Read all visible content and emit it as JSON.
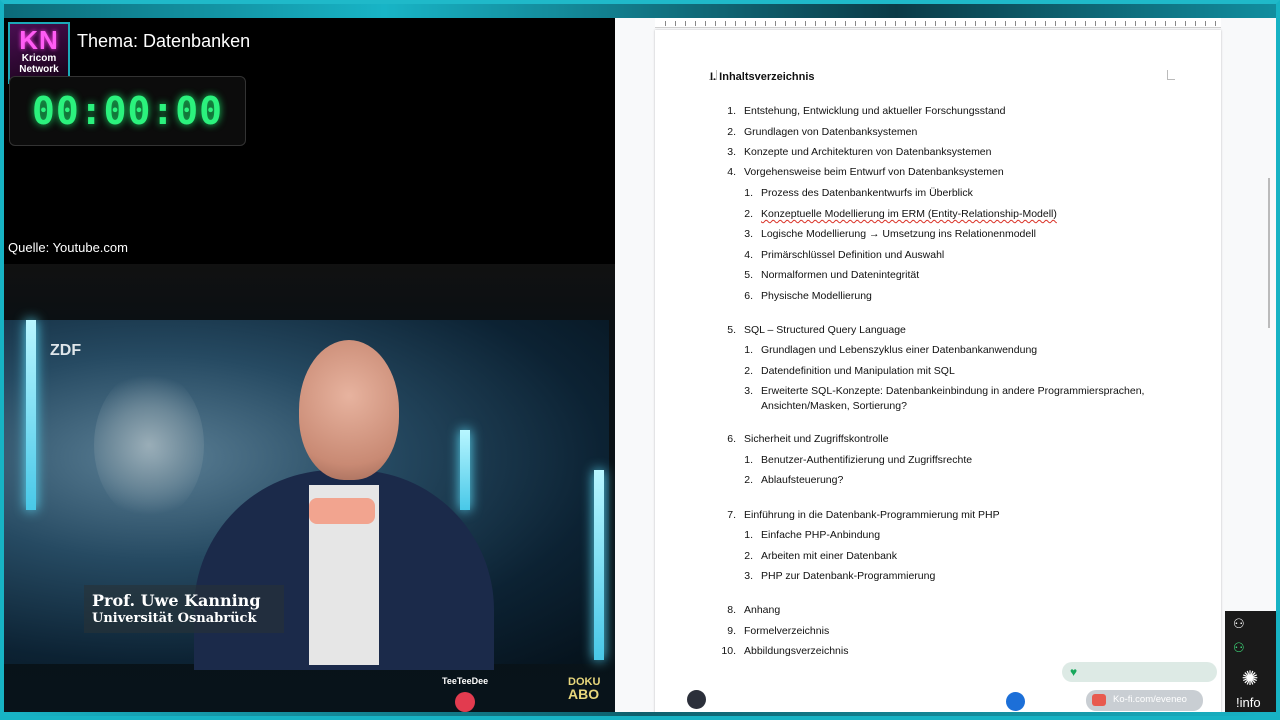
{
  "stream": {
    "logo_main": "KN",
    "logo_sub_1": "Kricom",
    "logo_sub_2": "Network",
    "topic": "Thema: Datenbanken",
    "timer": "00:00:00",
    "source": "Quelle: Youtube.com"
  },
  "video": {
    "channel_logo": "ZDF",
    "lower_third_name": "Prof. Uwe Kanning",
    "lower_third_role": "Universität Osnabrück",
    "viewer_name": "TeeTeeDee",
    "badge_line1": "DOKU",
    "badge_line2": "ABO"
  },
  "document": {
    "title": "I. Inhaltsverzeichnis",
    "items": [
      {
        "num": "1.",
        "text": "Entstehung, Entwicklung und aktueller Forschungsstand"
      },
      {
        "num": "2.",
        "text": "Grundlagen von Datenbanksystemen"
      },
      {
        "num": "3.",
        "text": "Konzepte und Architekturen von Datenbanksystemen"
      },
      {
        "num": "4.",
        "text": "Vorgehensweise beim Entwurf von Datenbanksystemen"
      },
      {
        "num": "1.",
        "text": "Prozess des Datenbankentwurfs im Überblick"
      },
      {
        "num": "2.",
        "text": "Konzeptuelle Modellierung im ERM (Entity-Relationship-Modell)"
      },
      {
        "num": "3.",
        "text": "Logische Modellierung → Umsetzung ins Relationenmodell"
      },
      {
        "num": "4.",
        "text": "Primärschlüssel Definition und Auswahl"
      },
      {
        "num": "5.",
        "text": "Normalformen und Datenintegrität"
      },
      {
        "num": "6.",
        "text": "Physische Modellierung"
      },
      {
        "num": "5.",
        "text": "SQL – Structured Query Language"
      },
      {
        "num": "1.",
        "text": "Grundlagen und Lebenszyklus einer Datenbankanwendung"
      },
      {
        "num": "2.",
        "text": "Datendefinition und Manipulation mit SQL"
      },
      {
        "num": "3.",
        "text": "Erweiterte SQL-Konzepte: Datenbankeinbindung in andere Programmiersprachen,"
      },
      {
        "num": "",
        "text": "Ansichten/Masken, Sortierung?"
      },
      {
        "num": "6.",
        "text": "Sicherheit und Zugriffskontrolle"
      },
      {
        "num": "1.",
        "text": "Benutzer-Authentifizierung und Zugriffsrechte"
      },
      {
        "num": "2.",
        "text": "Ablaufsteuerung?"
      },
      {
        "num": "7.",
        "text": "Einführung in die Datenbank-Programmierung mit PHP"
      },
      {
        "num": "1.",
        "text": "Einfache PHP-Anbindung"
      },
      {
        "num": "2.",
        "text": "Arbeiten mit einer Datenbank"
      },
      {
        "num": "3.",
        "text": "PHP zur Datenbank-Programmierung"
      },
      {
        "num": "8.",
        "text": "Anhang"
      },
      {
        "num": "9.",
        "text": "Formelverzeichnis"
      },
      {
        "num": "10.",
        "text": "Abbildungsverzeichnis"
      }
    ]
  },
  "overlays": {
    "kofi_label": "Ko-fi.com/eveneo",
    "info_label": "!info",
    "heart_icon": "heart-icon",
    "kofi_icon": "cup-icon"
  }
}
